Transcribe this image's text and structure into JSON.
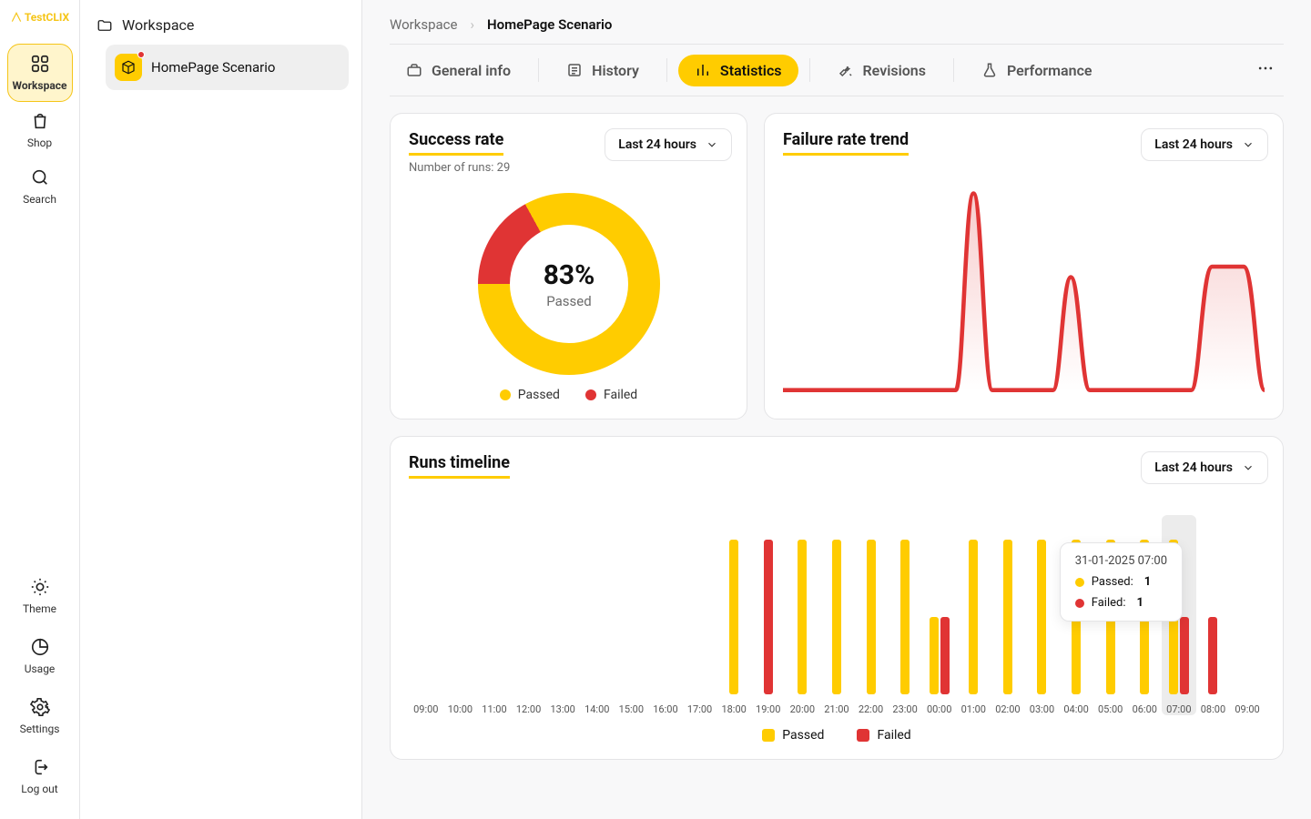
{
  "brand": "TestCLIX",
  "rail": {
    "workspace": "Workspace",
    "shop": "Shop",
    "search": "Search",
    "theme": "Theme",
    "usage": "Usage",
    "settings": "Settings",
    "logout": "Log out"
  },
  "tree": {
    "root": "Workspace",
    "node": "HomePage Scenario"
  },
  "crumbs": {
    "root": "Workspace",
    "current": "HomePage Scenario"
  },
  "tabs": {
    "general": "General info",
    "history": "History",
    "statistics": "Statistics",
    "revisions": "Revisions",
    "performance": "Performance"
  },
  "success_rate": {
    "title": "Success rate",
    "subtitle": "Number of runs: 29",
    "range": "Last 24 hours",
    "percent": "83%",
    "passed_label": "Passed",
    "legend_passed": "Passed",
    "legend_failed": "Failed"
  },
  "failure_trend": {
    "title": "Failure rate trend",
    "range": "Last 24 hours"
  },
  "runs_timeline": {
    "title": "Runs timeline",
    "range": "Last 24 hours",
    "legend_passed": "Passed",
    "legend_failed": "Failed",
    "tooltip": {
      "title": "31-01-2025 07:00",
      "passed_label": "Passed:",
      "passed_val": "1",
      "failed_label": "Failed:",
      "failed_val": "1"
    }
  },
  "chart_data": [
    {
      "id": "success_rate_donut",
      "type": "pie",
      "title": "Success rate",
      "series": [
        {
          "name": "Passed",
          "value": 83,
          "color": "#ffcc00"
        },
        {
          "name": "Failed",
          "value": 17,
          "color": "#e03434"
        }
      ],
      "center_label": "83% Passed",
      "total_runs": 29
    },
    {
      "id": "failure_rate_trend",
      "type": "area",
      "title": "Failure rate trend",
      "xlabel": "",
      "ylabel": "",
      "x_hours": [
        "09:00",
        "10:00",
        "11:00",
        "12:00",
        "13:00",
        "14:00",
        "15:00",
        "16:00",
        "17:00",
        "18:00",
        "19:00",
        "20:00",
        "21:00",
        "22:00",
        "23:00",
        "00:00",
        "01:00",
        "02:00",
        "03:00",
        "04:00",
        "05:00",
        "06:00",
        "07:00",
        "08:00",
        "09:00"
      ],
      "values": [
        0,
        0,
        0,
        0,
        0,
        0,
        0,
        0,
        0,
        0.95,
        0,
        0,
        0,
        0,
        0.55,
        0,
        0,
        0,
        0,
        0,
        0,
        0,
        0.6,
        0.6,
        0
      ],
      "ylim": [
        0,
        1
      ],
      "color": "#e03434"
    },
    {
      "id": "runs_timeline",
      "type": "bar",
      "title": "Runs timeline",
      "categories": [
        "09:00",
        "10:00",
        "11:00",
        "12:00",
        "13:00",
        "14:00",
        "15:00",
        "16:00",
        "17:00",
        "18:00",
        "19:00",
        "20:00",
        "21:00",
        "22:00",
        "23:00",
        "00:00",
        "01:00",
        "02:00",
        "03:00",
        "04:00",
        "05:00",
        "06:00",
        "07:00",
        "08:00",
        "09:00"
      ],
      "series": [
        {
          "name": "Passed",
          "color": "#ffcc00",
          "values": [
            0,
            0,
            0,
            0,
            0,
            0,
            0,
            0,
            0,
            2,
            0,
            2,
            2,
            2,
            2,
            1,
            2,
            2,
            2,
            2,
            2,
            2,
            2,
            0,
            0
          ]
        },
        {
          "name": "Failed",
          "color": "#e03434",
          "values": [
            0,
            0,
            0,
            0,
            0,
            0,
            0,
            0,
            0,
            0,
            2,
            0,
            0,
            0,
            0,
            1,
            0,
            0,
            0,
            0,
            0,
            0,
            1,
            1,
            0
          ]
        }
      ],
      "ylim": [
        0,
        2
      ],
      "highlight_index": 22,
      "tooltip": {
        "index": 22,
        "title": "31-01-2025 07:00",
        "Passed": 1,
        "Failed": 1
      }
    }
  ]
}
